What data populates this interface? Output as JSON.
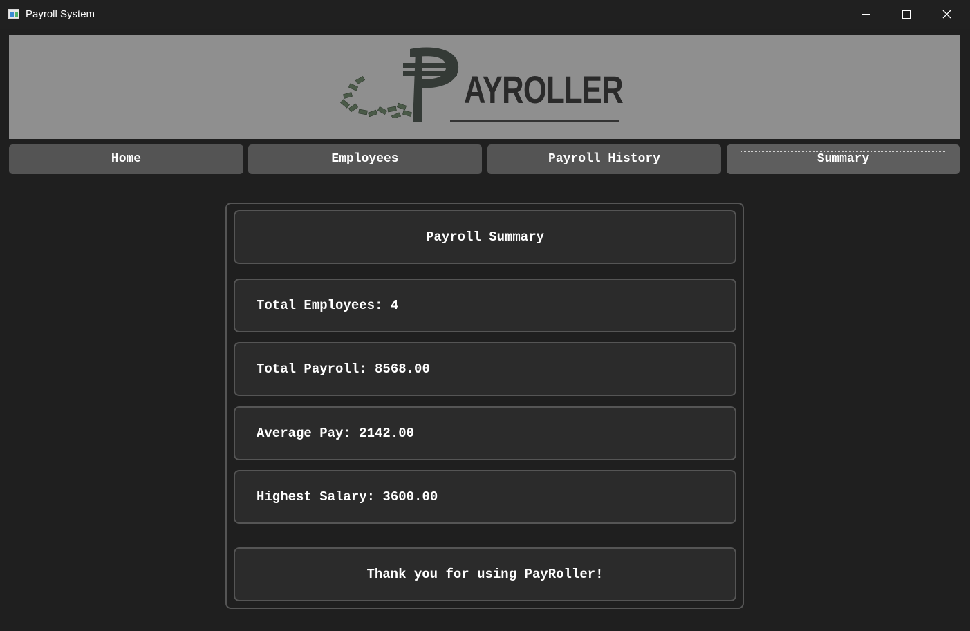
{
  "window": {
    "title": "Payroll System"
  },
  "banner": {
    "logo_text": "AYROLLER",
    "logo_mark": "₱"
  },
  "nav": {
    "tabs": [
      {
        "label": "Home"
      },
      {
        "label": "Employees"
      },
      {
        "label": "Payroll History"
      },
      {
        "label": "Summary"
      }
    ],
    "active": "Summary"
  },
  "summary": {
    "heading": "Payroll Summary",
    "total_employees": "Total Employees: 4",
    "total_payroll": "Total Payroll: 8568.00",
    "average_pay": "Average Pay: 2142.00",
    "highest_salary": "Highest Salary: 3600.00",
    "footer": "Thank you for using PayRoller!"
  },
  "colors": {
    "background": "#1f1f1f",
    "banner": "#8f8f8f",
    "button": "#545454",
    "card": "#2b2b2b",
    "border": "#555555"
  },
  "icons": [
    "app-window-icon",
    "minimize-icon",
    "maximize-icon",
    "close-icon",
    "peso-logo-icon",
    "money-bills-icon"
  ]
}
